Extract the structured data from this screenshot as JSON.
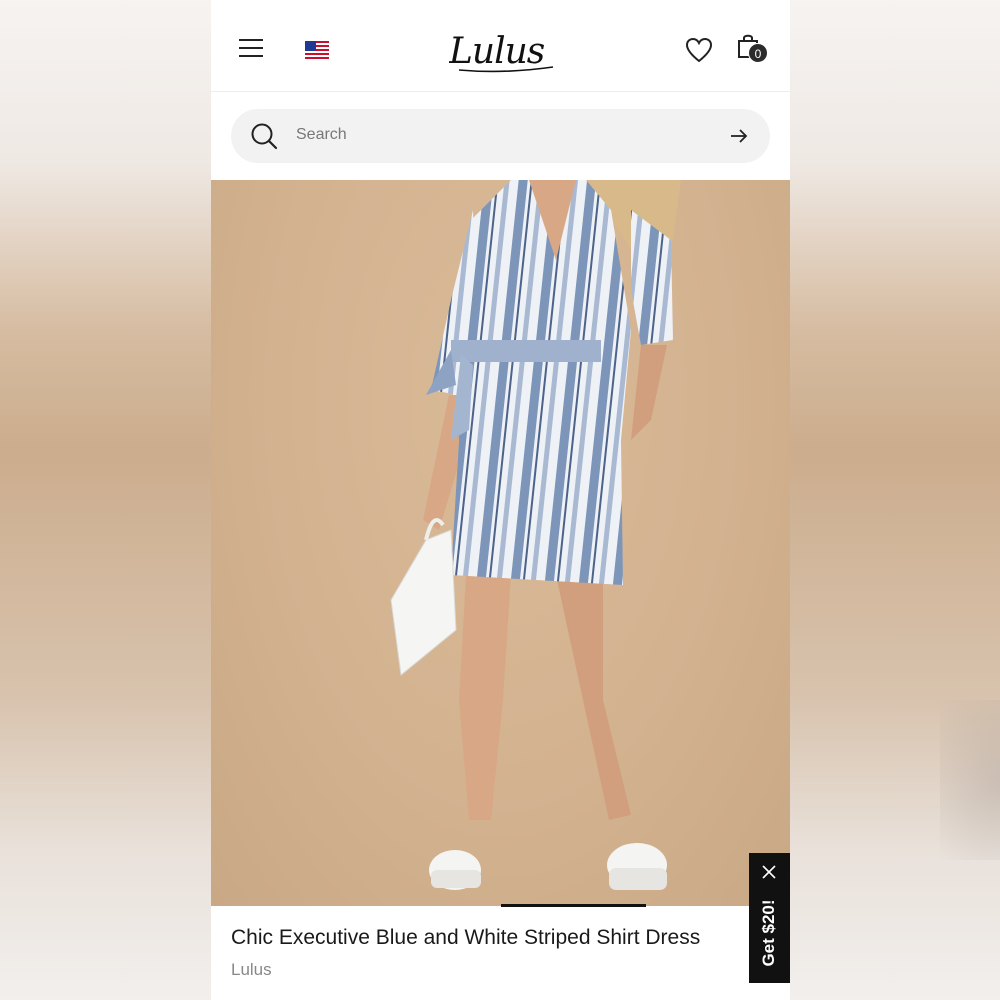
{
  "header": {
    "menu_icon": "hamburger-menu-icon",
    "flag_icon": "us-flag-icon",
    "logo_text": "Lulus",
    "wishlist_icon": "heart-icon",
    "cart_icon": "shopping-bag-icon",
    "cart_count": "0"
  },
  "search": {
    "placeholder": "Search",
    "search_icon": "search-icon",
    "submit_icon": "arrow-right-icon"
  },
  "product": {
    "image_icon": "product-photo",
    "title": "Chic Executive Blue and White Striped Shirt Dress",
    "brand": "Lulus",
    "carousel_position": 0.5
  },
  "promo": {
    "label": "Get $20!",
    "close_icon": "close-icon"
  },
  "colors": {
    "text_primary": "#1a1a1a",
    "text_secondary": "#888888",
    "search_bg": "#f2f2f2",
    "promo_bg": "#111111",
    "badge_bg": "#2b2b2b",
    "photo_bg": "#d3b290"
  }
}
